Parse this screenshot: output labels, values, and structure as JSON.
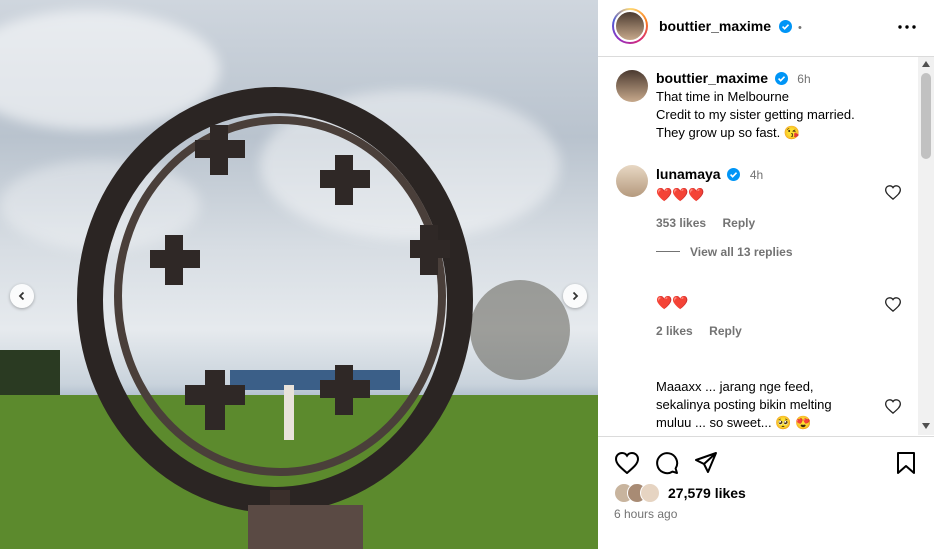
{
  "post": {
    "username": "bouttier_maxime",
    "dot": "•",
    "caption_line1": "That time in Melbourne",
    "caption_line2": "Credit to my sister getting married.",
    "caption_line3": "They grow up so fast. 😘",
    "caption_time": "6h"
  },
  "comments": [
    {
      "username": "lunamaya",
      "time": "4h",
      "text": "❤️❤️❤️",
      "likes": "353 likes",
      "reply": "Reply",
      "view_replies": "View all 13 replies"
    },
    {
      "username": "",
      "time": "",
      "text": "❤️❤️",
      "likes": "2 likes",
      "reply": "Reply"
    },
    {
      "username": "",
      "time": "",
      "text_line1": "Maaaxx ... jarang nge feed,",
      "text_line2": "sekalinya posting bikin melting",
      "text_line3": "muluu ... so sweet... 🥺 😍"
    }
  ],
  "footer": {
    "likes_count": "27,579 likes",
    "time_ago": "6 hours ago"
  },
  "icons": {
    "more": "more-options-icon",
    "like": "heart-icon",
    "comment": "comment-icon",
    "share": "share-icon",
    "save": "bookmark-icon"
  },
  "colors": {
    "verified": "#0095f6",
    "muted": "#737373",
    "border": "#dbdbdb"
  }
}
